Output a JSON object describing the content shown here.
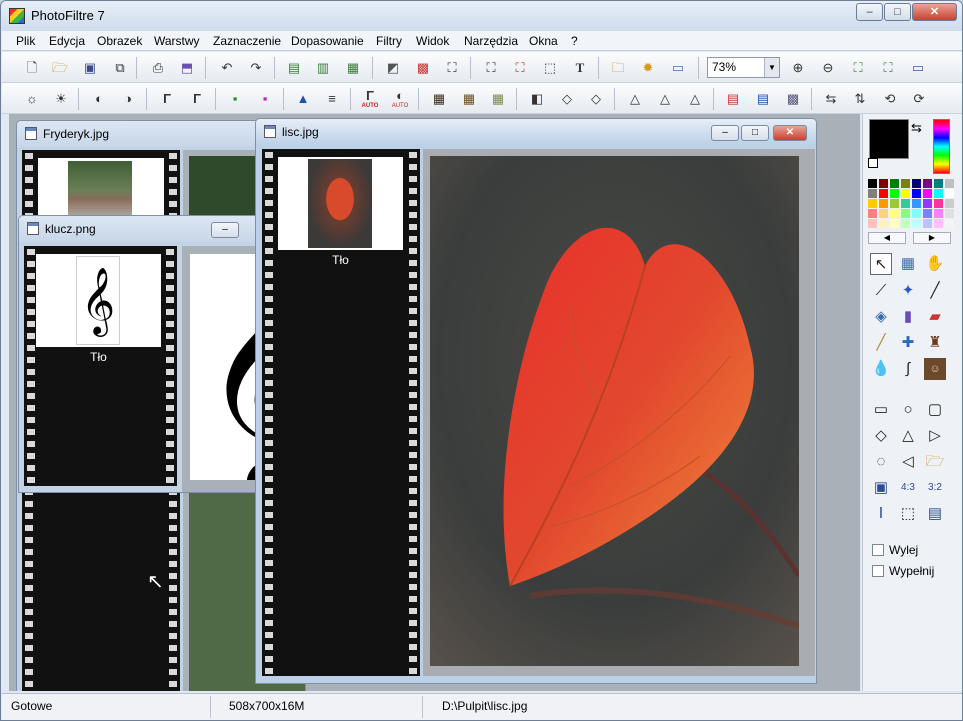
{
  "app": {
    "title": "PhotoFiltre 7",
    "min": "–",
    "max": "□",
    "close": "✕"
  },
  "menu": [
    "Plik",
    "Edycja",
    "Obrazek",
    "Warstwy",
    "Zaznaczenie",
    "Dopasowanie",
    "Filtry",
    "Widok",
    "Narzędzia",
    "Okna",
    "?"
  ],
  "toolbar1": {
    "zoom_value": "73%",
    "zoom_arrow": "▼"
  },
  "toolbar2": {
    "auto1": "AUTO",
    "auto2": "AUTO"
  },
  "windows": {
    "fryderyk": {
      "title": "Fryderyk.jpg"
    },
    "klucz": {
      "title": "klucz.png",
      "layer": "Tło",
      "thumb_glyph": "𝄞",
      "big_glyph": "𝄞"
    },
    "lisc": {
      "title": "lisc.jpg",
      "layer": "Tło"
    }
  },
  "rightpanel": {
    "checkboxes": [
      {
        "label": "Wylej",
        "checked": false
      },
      {
        "label": "Wypełnij",
        "checked": false
      }
    ],
    "primary_color": "#000000",
    "secondary_color": "#ffffff"
  },
  "status": {
    "state": "Gotowe",
    "size": "508x700x16M",
    "path": "D:\\Pulpit\\lisc.jpg"
  }
}
